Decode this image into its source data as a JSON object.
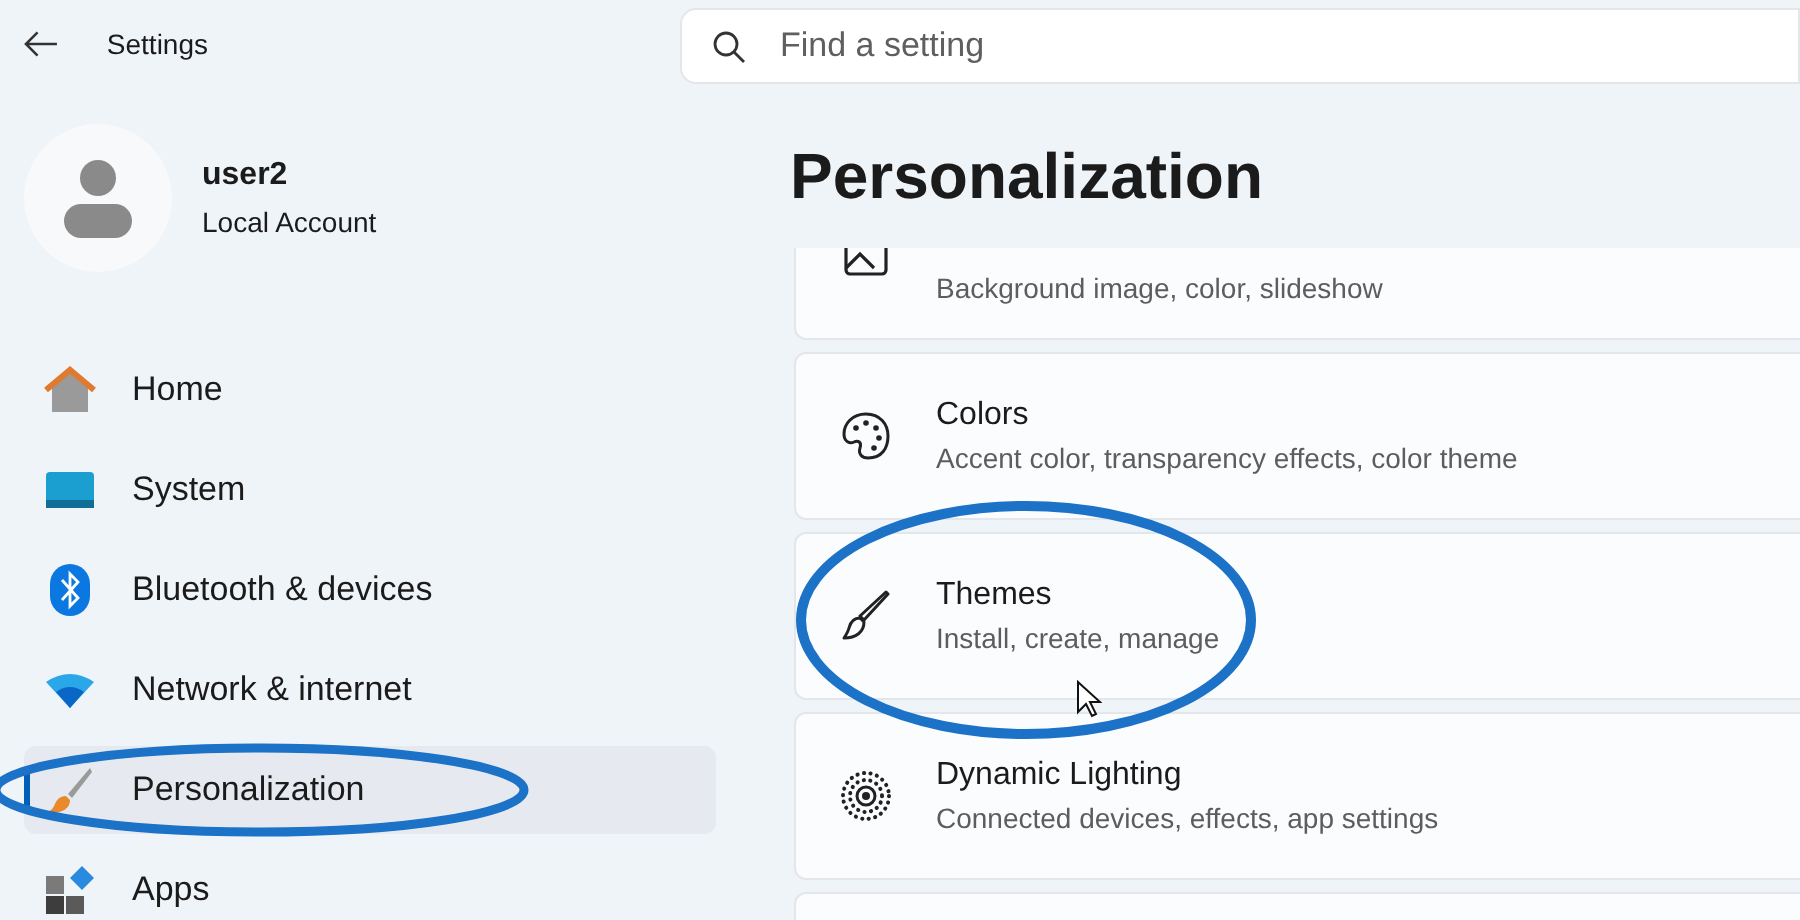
{
  "window": {
    "title": "Settings"
  },
  "search": {
    "placeholder": "Find a setting"
  },
  "account": {
    "name": "user2",
    "type": "Local Account"
  },
  "sidebar": {
    "items": [
      {
        "label": "Home",
        "selected": false,
        "circled": false
      },
      {
        "label": "System",
        "selected": false,
        "circled": false
      },
      {
        "label": "Bluetooth & devices",
        "selected": false,
        "circled": false
      },
      {
        "label": "Network & internet",
        "selected": false,
        "circled": false
      },
      {
        "label": "Personalization",
        "selected": true,
        "circled": true
      },
      {
        "label": "Apps",
        "selected": false,
        "circled": false
      }
    ]
  },
  "page": {
    "title": "Personalization",
    "items": [
      {
        "description": "Background image, color, slideshow",
        "circled": false
      },
      {
        "title": "Colors",
        "description": "Accent color, transparency effects, color theme",
        "circled": false
      },
      {
        "title": "Themes",
        "description": "Install, create, manage",
        "circled": true
      },
      {
        "title": "Dynamic Lighting",
        "description": "Connected devices, effects, app settings",
        "circled": false
      },
      {
        "circled": false
      }
    ]
  }
}
